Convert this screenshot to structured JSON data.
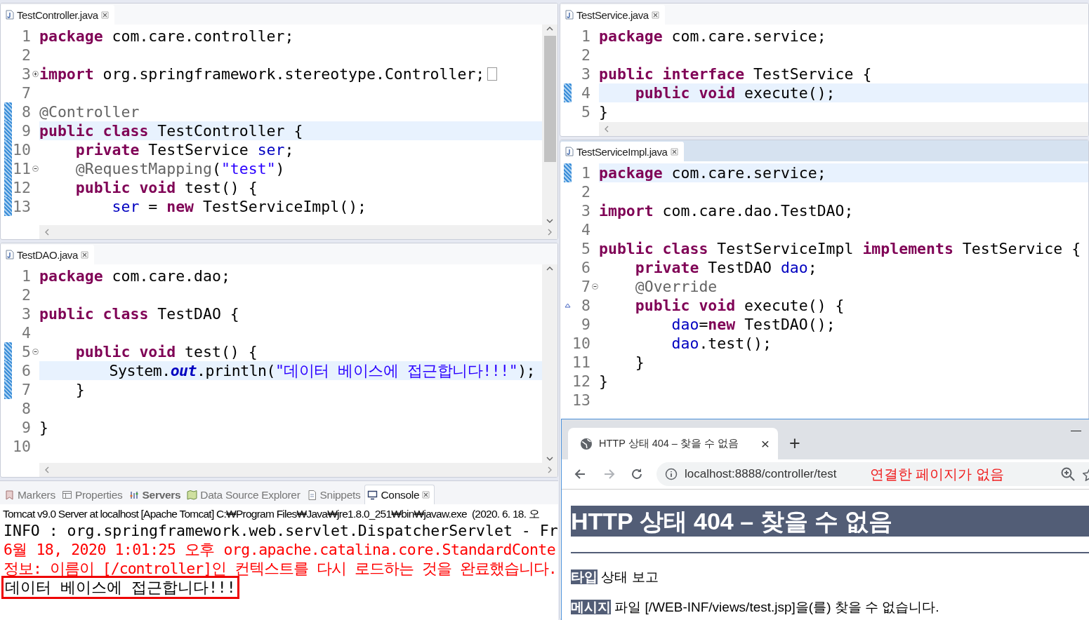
{
  "left_column": {
    "editors": [
      {
        "file": "TestController.java",
        "active": false,
        "lines": [
          {
            "number": "1",
            "current": false,
            "changed": false,
            "foldable": false,
            "code": [
              {
                "kind": "keyword",
                "text": "package"
              },
              {
                "kind": "plain",
                "text": " com.care.controller;"
              }
            ]
          },
          {
            "number": "2",
            "current": false,
            "changed": false,
            "foldable": false
          },
          {
            "number": "3",
            "current": false,
            "changed": false,
            "foldable": true,
            "folded": true,
            "code": [
              {
                "kind": "keyword",
                "text": "import"
              },
              {
                "kind": "plain",
                "text": " org.springframework.stereotype.Controller;"
              }
            ]
          },
          {
            "number": "7",
            "current": false,
            "changed": false,
            "foldable": false
          },
          {
            "number": "8",
            "current": false,
            "changed": true,
            "foldable": false,
            "code": [
              {
                "kind": "annotation",
                "text": "@Controller"
              }
            ]
          },
          {
            "number": "9",
            "current": true,
            "changed": true,
            "foldable": false,
            "code": [
              {
                "kind": "keyword",
                "text": "public class"
              },
              {
                "kind": "plain",
                "text": " TestController {"
              }
            ]
          },
          {
            "number": "10",
            "current": false,
            "changed": true,
            "foldable": false,
            "code": [
              {
                "kind": "keyword",
                "text": "    private"
              },
              {
                "kind": "plain",
                "text": " TestService "
              },
              {
                "kind": "field",
                "text": "ser"
              },
              {
                "kind": "plain",
                "text": ";"
              }
            ]
          },
          {
            "number": "11",
            "current": false,
            "changed": true,
            "foldable": true,
            "folded": false,
            "code": [
              {
                "kind": "annotation",
                "text": "    @RequestMapping"
              },
              {
                "kind": "plain",
                "text": "("
              },
              {
                "kind": "string",
                "text": "\"test\""
              },
              {
                "kind": "plain",
                "text": ")"
              }
            ]
          },
          {
            "number": "12",
            "current": false,
            "changed": true,
            "foldable": false,
            "code": [
              {
                "kind": "keyword",
                "text": "    public void"
              },
              {
                "kind": "plain",
                "text": " test() {"
              }
            ]
          },
          {
            "number": "13",
            "current": false,
            "changed": true,
            "foldable": false,
            "code": [
              {
                "kind": "field",
                "text": "        ser"
              },
              {
                "kind": "plain",
                "text": " = "
              },
              {
                "kind": "keyword",
                "text": "new"
              },
              {
                "kind": "plain",
                "text": " TestServiceImpl();"
              }
            ]
          }
        ]
      },
      {
        "file": "TestDAO.java",
        "active": false,
        "lines": [
          {
            "number": "1",
            "current": false,
            "changed": false,
            "foldable": false,
            "code": [
              {
                "kind": "keyword",
                "text": "package"
              },
              {
                "kind": "plain",
                "text": " com.care.dao;"
              }
            ]
          },
          {
            "number": "2",
            "current": false,
            "changed": false,
            "foldable": false
          },
          {
            "number": "3",
            "current": false,
            "changed": false,
            "foldable": false,
            "code": [
              {
                "kind": "keyword",
                "text": "public class"
              },
              {
                "kind": "plain",
                "text": " TestDAO {"
              }
            ]
          },
          {
            "number": "4",
            "current": false,
            "changed": false,
            "foldable": false
          },
          {
            "number": "5",
            "current": false,
            "changed": true,
            "foldable": true,
            "folded": false,
            "code": [
              {
                "kind": "keyword",
                "text": "    public void"
              },
              {
                "kind": "plain",
                "text": " test() {"
              }
            ]
          },
          {
            "number": "6",
            "current": true,
            "changed": true,
            "foldable": false,
            "code": [
              {
                "kind": "plain",
                "text": "        System."
              },
              {
                "kind": "static_field",
                "text": "out"
              },
              {
                "kind": "plain",
                "text": ".println("
              },
              {
                "kind": "string",
                "text": "\"데이터 베이스에 접근합니다!!!\""
              },
              {
                "kind": "plain",
                "text": ");"
              }
            ]
          },
          {
            "number": "7",
            "current": false,
            "changed": true,
            "foldable": false,
            "code": [
              {
                "kind": "plain",
                "text": "    }"
              }
            ]
          },
          {
            "number": "8",
            "current": false,
            "changed": false,
            "foldable": false
          },
          {
            "number": "9",
            "current": false,
            "changed": false,
            "foldable": false,
            "code": [
              {
                "kind": "plain",
                "text": "}"
              }
            ]
          },
          {
            "number": "10",
            "current": false,
            "changed": false,
            "foldable": false
          }
        ]
      }
    ],
    "console": {
      "tabs": [
        {
          "label": "Markers",
          "selected": false,
          "updated": false
        },
        {
          "label": "Properties",
          "selected": false,
          "updated": false
        },
        {
          "label": "Servers",
          "selected": false,
          "updated": true
        },
        {
          "label": "Data Source Explorer",
          "selected": false,
          "updated": false
        },
        {
          "label": "Snippets",
          "selected": false,
          "updated": false
        },
        {
          "label": "Console",
          "selected": true,
          "updated": false
        }
      ],
      "description": "Tomcat v9.0 Server at localhost [Apache Tomcat] C:₩Program Files₩Java₩jre1.8.0_251₩bin₩javaw.exe  (2020. 6. 18. 오",
      "lines": [
        {
          "text": "INFO : org.springframework.web.servlet.DispatcherServlet - Fr",
          "error": false,
          "boxed": false
        },
        {
          "text": "6월 18, 2020 1:01:25 오후 org.apache.catalina.core.StandardConte",
          "error": true,
          "boxed": false
        },
        {
          "text": "정보: 이름이 [/controller]인 컨텍스트를 다시 로드하는 것을 완료했습니다.",
          "error": true,
          "boxed": false
        },
        {
          "text": "데이터 베이스에 접근합니다!!!",
          "error": false,
          "boxed": true
        }
      ]
    }
  },
  "right_column": {
    "editors": [
      {
        "file": "TestService.java",
        "active": false,
        "lines": [
          {
            "number": "1",
            "current": false,
            "changed": false,
            "foldable": false,
            "code": [
              {
                "kind": "keyword",
                "text": "package"
              },
              {
                "kind": "plain",
                "text": " com.care.service;"
              }
            ]
          },
          {
            "number": "2",
            "current": false,
            "changed": false,
            "foldable": false
          },
          {
            "number": "3",
            "current": false,
            "changed": false,
            "foldable": false,
            "code": [
              {
                "kind": "keyword",
                "text": "public interface"
              },
              {
                "kind": "plain",
                "text": " TestService {"
              }
            ]
          },
          {
            "number": "4",
            "current": true,
            "changed": true,
            "foldable": false,
            "code": [
              {
                "kind": "keyword",
                "text": "    public void"
              },
              {
                "kind": "plain",
                "text": " execute();"
              }
            ]
          },
          {
            "number": "5",
            "current": false,
            "changed": false,
            "foldable": false,
            "code": [
              {
                "kind": "plain",
                "text": "}"
              }
            ]
          }
        ]
      },
      {
        "file": "TestServiceImpl.java",
        "active": true,
        "lines": [
          {
            "number": "1",
            "current": true,
            "changed": true,
            "foldable": false,
            "code": [
              {
                "kind": "keyword",
                "text": "package"
              },
              {
                "kind": "plain",
                "text": " com.care.service;"
              }
            ]
          },
          {
            "number": "2",
            "current": false,
            "changed": false,
            "foldable": false
          },
          {
            "number": "3",
            "current": false,
            "changed": false,
            "foldable": false,
            "code": [
              {
                "kind": "keyword",
                "text": "import"
              },
              {
                "kind": "plain",
                "text": " com.care.dao.TestDAO;"
              }
            ]
          },
          {
            "number": "4",
            "current": false,
            "changed": false,
            "foldable": false
          },
          {
            "number": "5",
            "current": false,
            "changed": false,
            "foldable": false,
            "code": [
              {
                "kind": "keyword",
                "text": "public class"
              },
              {
                "kind": "plain",
                "text": " TestServiceImpl "
              },
              {
                "kind": "keyword",
                "text": "implements"
              },
              {
                "kind": "plain",
                "text": " TestService {"
              }
            ]
          },
          {
            "number": "6",
            "current": false,
            "changed": false,
            "foldable": false,
            "code": [
              {
                "kind": "keyword",
                "text": "    private"
              },
              {
                "kind": "plain",
                "text": " TestDAO "
              },
              {
                "kind": "field",
                "text": "dao"
              },
              {
                "kind": "plain",
                "text": ";"
              }
            ]
          },
          {
            "number": "7",
            "current": false,
            "changed": false,
            "foldable": true,
            "folded": false,
            "code": [
              {
                "kind": "annotation",
                "text": "    @Override"
              }
            ]
          },
          {
            "number": "8",
            "current": false,
            "changed": false,
            "foldable": false,
            "overrides": true,
            "code": [
              {
                "kind": "keyword",
                "text": "    public void"
              },
              {
                "kind": "plain",
                "text": " execute() {"
              }
            ]
          },
          {
            "number": "9",
            "current": false,
            "changed": false,
            "foldable": false,
            "code": [
              {
                "kind": "field",
                "text": "        dao"
              },
              {
                "kind": "plain",
                "text": "="
              },
              {
                "kind": "keyword",
                "text": "new"
              },
              {
                "kind": "plain",
                "text": " TestDAO();"
              }
            ]
          },
          {
            "number": "10",
            "current": false,
            "changed": false,
            "foldable": false,
            "code": [
              {
                "kind": "field",
                "text": "        dao"
              },
              {
                "kind": "plain",
                "text": ".test();"
              }
            ]
          },
          {
            "number": "11",
            "current": false,
            "changed": false,
            "foldable": false,
            "code": [
              {
                "kind": "plain",
                "text": "    }"
              }
            ]
          },
          {
            "number": "12",
            "current": false,
            "changed": false,
            "foldable": false,
            "code": [
              {
                "kind": "plain",
                "text": "}"
              }
            ]
          },
          {
            "number": "13",
            "current": false,
            "changed": false,
            "foldable": false
          }
        ]
      }
    ]
  },
  "browser": {
    "tab": {
      "title": "HTTP 상태 404 – 찾을 수 없음",
      "close": "×"
    },
    "new_tab": "+",
    "minimize": "—",
    "nav": [
      {
        "kind": "back",
        "disabled": false
      },
      {
        "kind": "forward",
        "disabled": true
      },
      {
        "kind": "reload",
        "disabled": false
      }
    ],
    "url": "localhost:8888/controller/test",
    "note": "연결한 페이지가 없음",
    "page": {
      "heading": "HTTP 상태 404 – 찾을 수 없음",
      "fields": [
        {
          "label": "타입",
          "value": "상태 보고"
        },
        {
          "label": "메시지",
          "value": "파일 [/WEB-INF/views/test.jsp]을(를) 찾을 수 없습니다."
        }
      ]
    }
  }
}
